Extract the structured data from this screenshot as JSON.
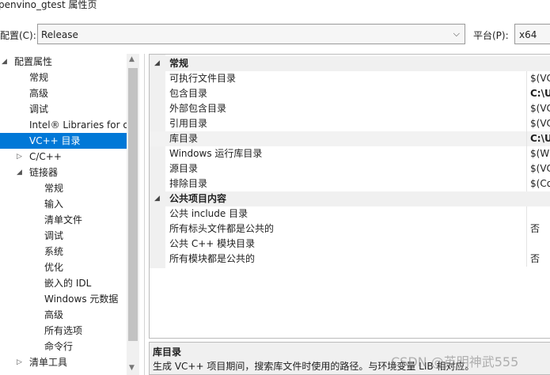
{
  "window": {
    "title": "penvino_gtest 属性页"
  },
  "config": {
    "label": "配置(C):",
    "value": "Release",
    "platform_label": "平台(P):",
    "platform_value": "x64"
  },
  "tree": {
    "items": [
      {
        "label": "配置属性",
        "arrow": "◢"
      },
      {
        "label": "常规"
      },
      {
        "label": "高级"
      },
      {
        "label": "调试"
      },
      {
        "label": "Intel® Libraries for o"
      },
      {
        "label": "VC++ 目录"
      },
      {
        "label": "C/C++",
        "arrow": "▷"
      },
      {
        "label": "链接器",
        "arrow": "◢"
      },
      {
        "label": "常规"
      },
      {
        "label": "输入"
      },
      {
        "label": "清单文件"
      },
      {
        "label": "调试"
      },
      {
        "label": "系统"
      },
      {
        "label": "优化"
      },
      {
        "label": "嵌入的 IDL"
      },
      {
        "label": "Windows 元数据"
      },
      {
        "label": "高级"
      },
      {
        "label": "所有选项"
      },
      {
        "label": "命令行"
      },
      {
        "label": "清单工具",
        "arrow": "▷"
      }
    ]
  },
  "grid": {
    "category1": "常规",
    "rows1": [
      {
        "name": "可执行文件目录",
        "value": "$(VC"
      },
      {
        "name": "包含目录",
        "value": "C:\\U"
      },
      {
        "name": "外部包含目录",
        "value": "$(VC"
      },
      {
        "name": "引用目录",
        "value": "$(VC"
      },
      {
        "name": "库目录",
        "value": "C:\\U"
      },
      {
        "name": "Windows 运行库目录",
        "value": "$(Wi"
      },
      {
        "name": "源目录",
        "value": "$(VC"
      },
      {
        "name": "排除目录",
        "value": "$(Co"
      }
    ],
    "category2": "公共项目内容",
    "rows2": [
      {
        "name": "公共 include 目录",
        "value": ""
      },
      {
        "name": "所有标头文件都是公共的",
        "value": "否"
      },
      {
        "name": "公共 C++ 模块目录",
        "value": ""
      },
      {
        "name": "所有模块都是公共的",
        "value": "否"
      }
    ]
  },
  "description": {
    "title": "库目录",
    "text": "生成 VC++ 项目期间，搜索库文件时使用的路径。与环境变量 LIB 相对应。"
  },
  "watermark": "CSDN @英明神武555"
}
